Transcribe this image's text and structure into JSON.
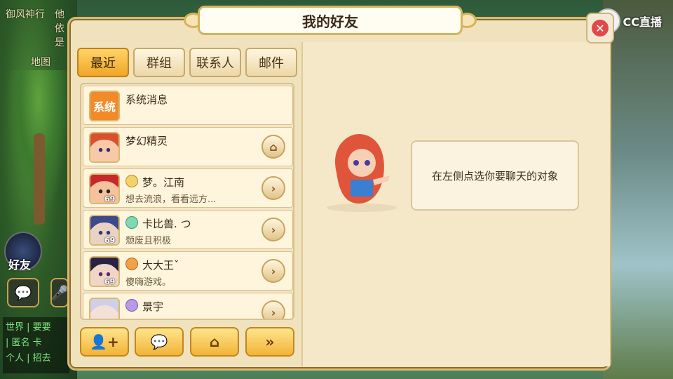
{
  "panel": {
    "title": "我的好友"
  },
  "tabs": [
    {
      "label": "最近",
      "active": true
    },
    {
      "label": "群组",
      "active": false
    },
    {
      "label": "联系人",
      "active": false
    },
    {
      "label": "邮件",
      "active": false
    }
  ],
  "list": [
    {
      "avatar": "系统",
      "name": "系统消息",
      "sig": "",
      "level": "",
      "action_icon": "none"
    },
    {
      "avatar": "red-hair-girl",
      "name": "梦幻精灵",
      "sig": "",
      "level": "",
      "action_icon": "home-icon"
    },
    {
      "avatar": "red-hair-boy",
      "name": "梦。江南",
      "sig": "想去流浪，看看远方...",
      "level": "69",
      "action_icon": "chevron-right-icon"
    },
    {
      "avatar": "blue-hair",
      "name": "卡比兽. つ",
      "sig": "颓废且积极",
      "level": "69",
      "action_icon": "chevron-right-icon"
    },
    {
      "avatar": "dark-hair",
      "name": "大大王ˇ",
      "sig": "傻嗨游戏。",
      "level": "69",
      "action_icon": "chevron-right-icon"
    },
    {
      "avatar": "white-hair",
      "name": "景宇",
      "sig": "",
      "level": "",
      "action_icon": "chevron-right-icon"
    }
  ],
  "bottom_buttons": [
    {
      "icon": "add-friend-icon",
      "glyph": "👤+"
    },
    {
      "icon": "chat-bubble-icon",
      "glyph": "💬"
    },
    {
      "icon": "home-icon",
      "glyph": "⌂"
    },
    {
      "icon": "double-chevron-icon",
      "glyph": "»"
    }
  ],
  "hint": {
    "text": "在左侧点选你要聊天的对象"
  },
  "hud": {
    "friends_label": "好友",
    "top_left_text": "御风神行",
    "top_left_text_2": "他依是",
    "map_label": "地图",
    "chat_lines": [
      "世界 | 要要",
      "| 匿名 卡",
      "个人 | 招去"
    ]
  },
  "watermark": {
    "text": "CC直播",
    "badge": "✕"
  },
  "colors": {
    "accent": "#f1b437",
    "panel_bg": "#f0e2bd",
    "tab_active": "#f0a628"
  }
}
